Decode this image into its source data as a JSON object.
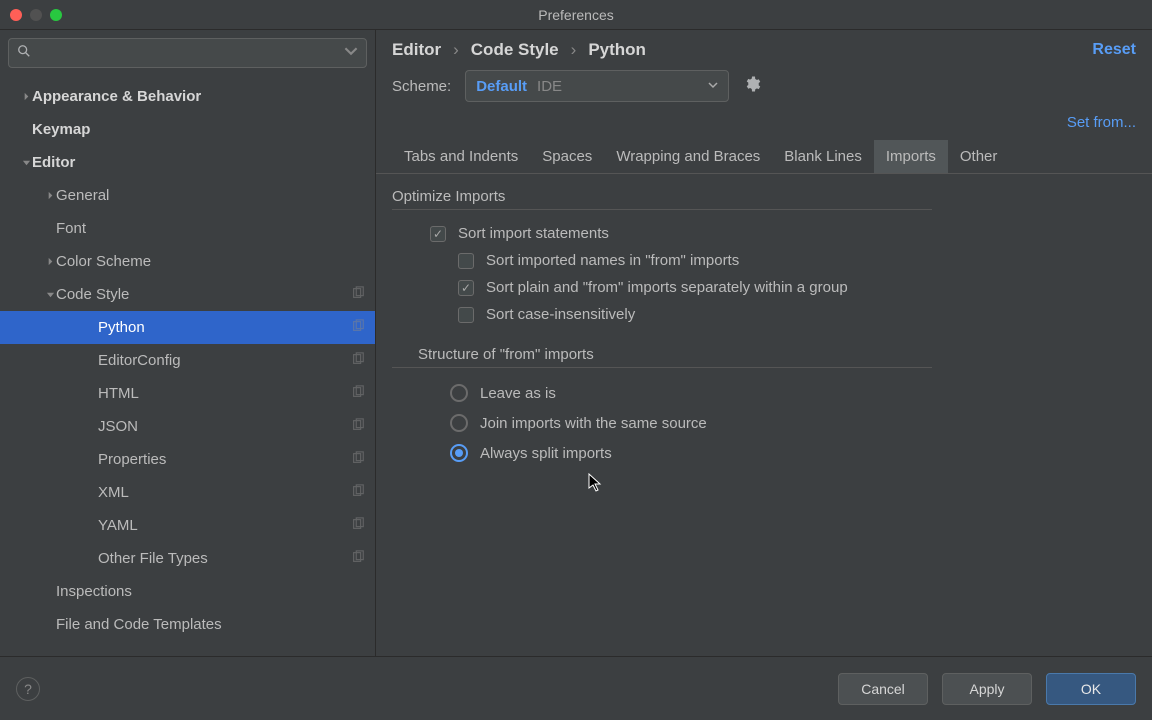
{
  "title": "Preferences",
  "search": {
    "placeholder": ""
  },
  "sidebar": {
    "items": [
      {
        "label": "Appearance & Behavior",
        "level": 0,
        "arrow": "right"
      },
      {
        "label": "Keymap",
        "level": 0
      },
      {
        "label": "Editor",
        "level": 0,
        "arrow": "down"
      },
      {
        "label": "General",
        "level": 1,
        "arrow": "right"
      },
      {
        "label": "Font",
        "level": 1
      },
      {
        "label": "Color Scheme",
        "level": 1,
        "arrow": "right"
      },
      {
        "label": "Code Style",
        "level": 1,
        "arrow": "down",
        "copy": true
      },
      {
        "label": "Python",
        "level": 2,
        "selected": true,
        "copy": true
      },
      {
        "label": "EditorConfig",
        "level": 2,
        "copy": true
      },
      {
        "label": "HTML",
        "level": 2,
        "copy": true
      },
      {
        "label": "JSON",
        "level": 2,
        "copy": true
      },
      {
        "label": "Properties",
        "level": 2,
        "copy": true
      },
      {
        "label": "XML",
        "level": 2,
        "copy": true
      },
      {
        "label": "YAML",
        "level": 2,
        "copy": true
      },
      {
        "label": "Other File Types",
        "level": 2,
        "copy": true
      },
      {
        "label": "Inspections",
        "level": 1
      },
      {
        "label": "File and Code Templates",
        "level": 1
      }
    ]
  },
  "breadcrumb": [
    "Editor",
    "Code Style",
    "Python"
  ],
  "reset": "Reset",
  "scheme": {
    "label": "Scheme:",
    "name": "Default",
    "scope": "IDE"
  },
  "setfrom": "Set from...",
  "tabs": [
    "Tabs and Indents",
    "Spaces",
    "Wrapping and Braces",
    "Blank Lines",
    "Imports",
    "Other"
  ],
  "active_tab": 4,
  "optimize": {
    "title": "Optimize Imports",
    "sort_statements": {
      "label": "Sort import statements",
      "checked": true
    },
    "sort_names": {
      "label": "Sort imported names in \"from\" imports",
      "checked": false
    },
    "sort_plain": {
      "label": "Sort plain and \"from\" imports separately within a group",
      "checked": true
    },
    "sort_case": {
      "label": "Sort case-insensitively",
      "checked": false
    }
  },
  "structure": {
    "title": "Structure of \"from\" imports",
    "options": [
      {
        "label": "Leave as is",
        "checked": false
      },
      {
        "label": "Join imports with the same source",
        "checked": false
      },
      {
        "label": "Always split imports",
        "checked": true
      }
    ]
  },
  "buttons": {
    "cancel": "Cancel",
    "apply": "Apply",
    "ok": "OK"
  }
}
